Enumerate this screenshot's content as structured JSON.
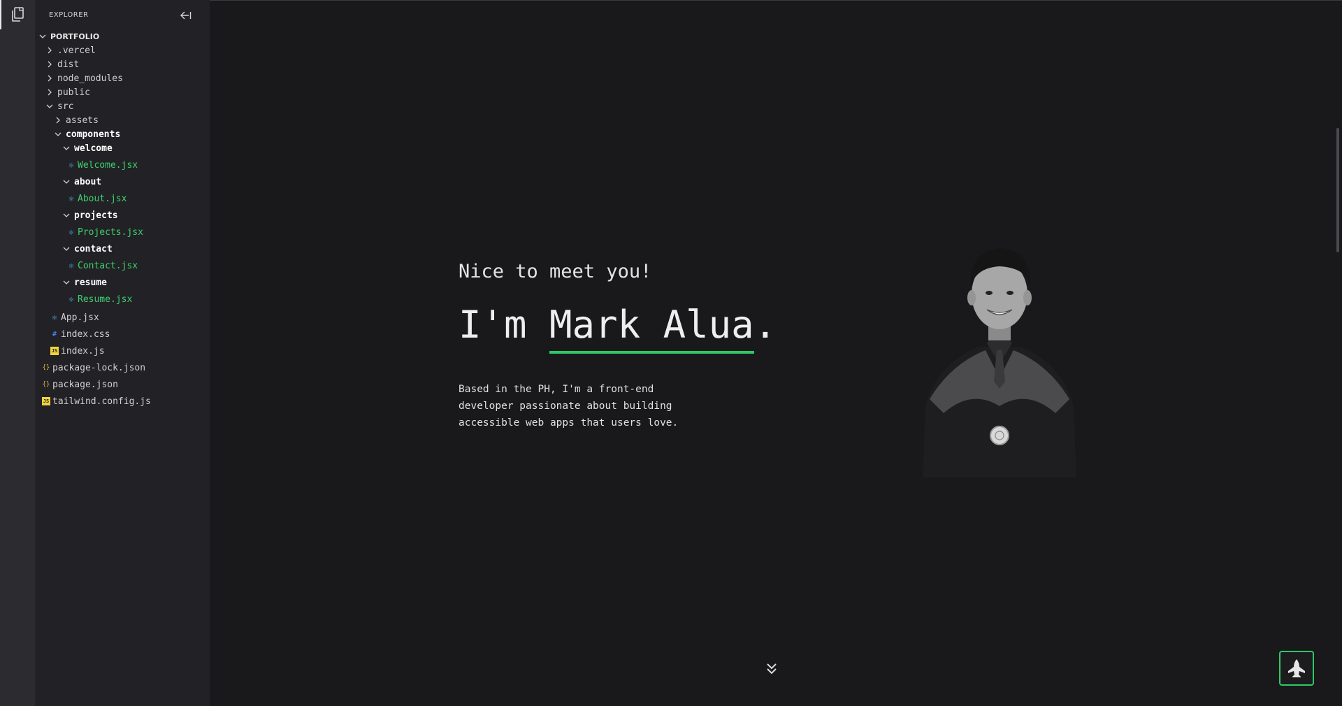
{
  "explorer": {
    "title": "EXPLORER",
    "root": "PORTFOLIO",
    "folders": {
      "vercel": ".vercel",
      "dist": "dist",
      "node_modules": "node_modules",
      "public": "public",
      "src": "src",
      "assets": "assets",
      "components": "components",
      "welcome": "welcome",
      "about": "about",
      "projects": "projects",
      "contact": "contact",
      "resume": "resume"
    },
    "files": {
      "welcome_jsx": "Welcome.jsx",
      "about_jsx": "About.jsx",
      "projects_jsx": "Projects.jsx",
      "contact_jsx": "Contact.jsx",
      "resume_jsx": "Resume.jsx",
      "app_jsx": "App.jsx",
      "index_css": "index.css",
      "index_js": "index.js",
      "package_lock": "package-lock.json",
      "package_json": "package.json",
      "tailwind_config": "tailwind.config.js"
    }
  },
  "hero": {
    "greeting": "Nice to meet you!",
    "headline_prefix": "I'm ",
    "name": "Mark Alua",
    "headline_suffix": ".",
    "bio": "Based in the PH, I'm a front-end developer passionate about building accessible web apps that users love."
  },
  "colors": {
    "accent": "#2ec866",
    "background": "#19191c",
    "sidebar": "#222226",
    "activity_bar": "#2c2c30"
  },
  "icons": {
    "explorer": "files-icon",
    "collapse": "collapse-sidebar-icon",
    "scroll": "double-chevron-down-icon",
    "rocket": "rocket-icon"
  }
}
